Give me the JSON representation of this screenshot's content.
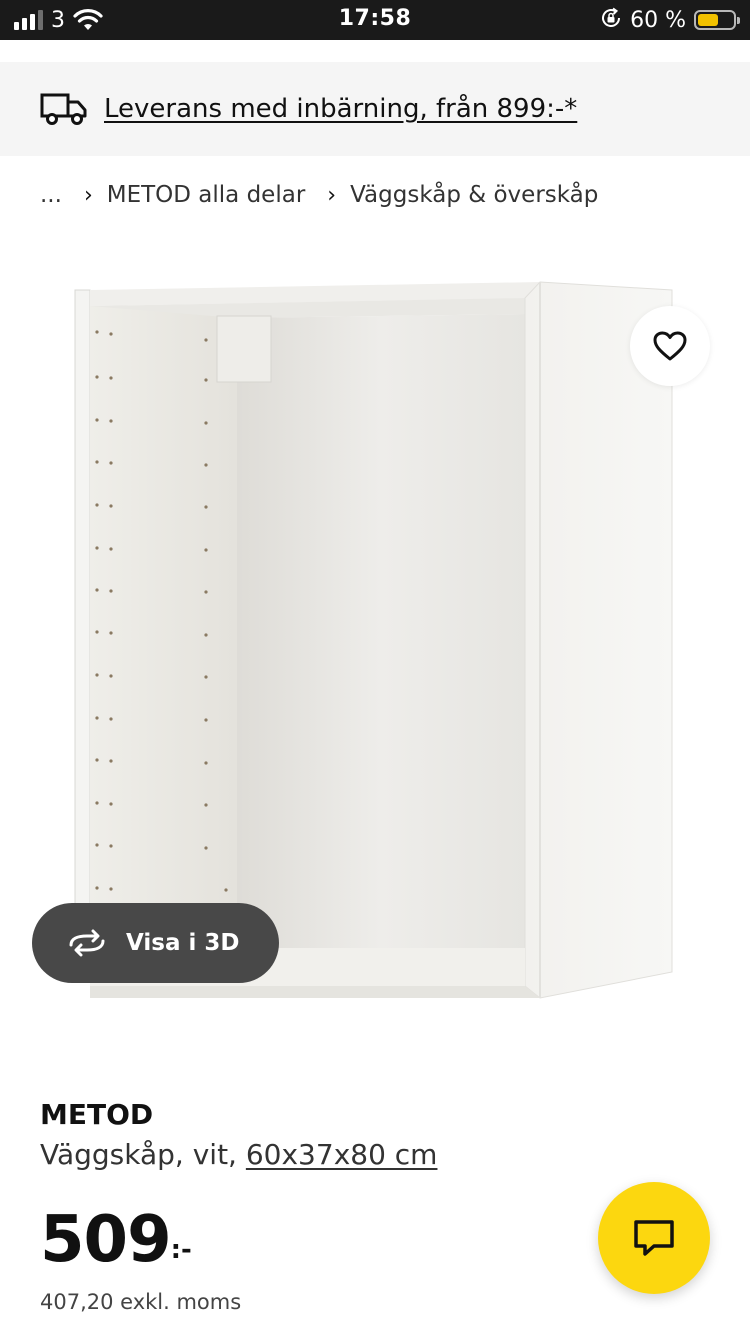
{
  "status_bar": {
    "carrier": "3",
    "time": "17:58",
    "battery_percent": "60 %",
    "battery_level": 0.6,
    "battery_color": "#f2c200"
  },
  "delivery": {
    "icon": "truck-icon",
    "text": "Leverans med inbärning, från 899:-*"
  },
  "breadcrumb": {
    "ellipsis": "...",
    "items": [
      "METOD alla delar",
      "Väggskåp & överskåp"
    ]
  },
  "product": {
    "name": "METOD",
    "description": "Väggskåp, vit, ",
    "dimensions": "60x37x80 cm",
    "price": "509",
    "price_suffix": ":-",
    "price_ex_vat": "407,20 exkl. moms"
  },
  "buttons": {
    "view_3d": "Visa i 3D",
    "favorite_icon": "heart-icon",
    "chat_icon": "chat-bubble-icon",
    "chat_color": "#fcd70f"
  }
}
